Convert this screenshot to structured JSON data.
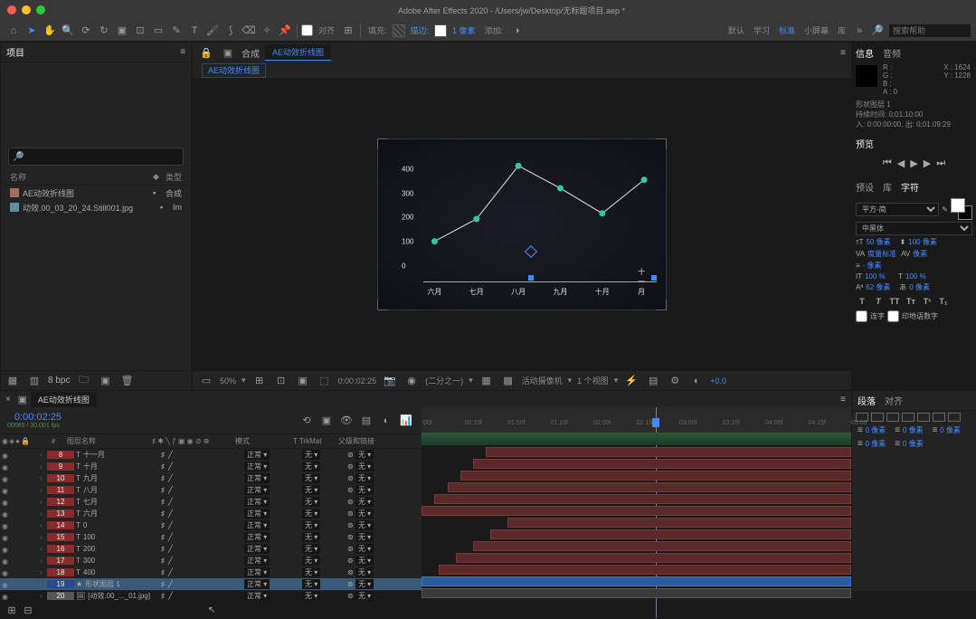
{
  "title": "Adobe After Effects 2020 - /Users/jw/Desktop/无标题项目.aep *",
  "toolbar": {
    "snap": "对齐",
    "fill": "填充:",
    "stroke": "描边:",
    "stroke_px": "1 像素",
    "add": "添加:",
    "workspace_default": "默认",
    "workspace_learn": "学习",
    "workspace_standard": "标准",
    "workspace_small": "小屏幕",
    "workspace_lib": "库",
    "search_placeholder": "搜索帮助"
  },
  "project": {
    "tab": "项目",
    "name_col": "名称",
    "type_col": "类型",
    "items": [
      {
        "name": "AE动效折线图",
        "type": "合成"
      },
      {
        "name": "动效.00_03_20_24.Still001.jpg",
        "type": "Im"
      }
    ],
    "bpc": "8 bpc"
  },
  "comp": {
    "prefix": "合成",
    "name": "AE动效折线图",
    "flow_tab": "AE动效折线图",
    "zoom": "50%",
    "time": "0:00:02:25",
    "res": "(二分之一)",
    "camera": "活动摄像机",
    "view": "1 个视图",
    "exposure": "+0.0"
  },
  "info": {
    "tab_info": "信息",
    "tab_audio": "音频",
    "r": "R :",
    "g": "G :",
    "b": "B :",
    "a": "A : 0",
    "x": "X : 1624",
    "y": "Y : 1228",
    "layer": "形状图层 1",
    "duration": "持续时间: 0;01:10:00",
    "in_out": "入: 0:00:00:00, 出: 0;01:09:29"
  },
  "preview": {
    "tab": "预览"
  },
  "char": {
    "tab_preset": "预设",
    "tab_lib": "库",
    "tab_char": "字符",
    "font": "平方-简",
    "weight": "中黑体",
    "size": "50 像素",
    "leading": "100 像素",
    "metrics": "度量标准",
    "kerning": "像素",
    "vscale": "100 %",
    "hscale": "100 %",
    "baseline": "0 像素",
    "stroke_w": "- 像素",
    "tracking": "62 像素",
    "ligature": "连字",
    "hindi": "印地语数字"
  },
  "chart_data": {
    "type": "line",
    "categories": [
      "六月",
      "七月",
      "八月",
      "九月",
      "十月",
      "十一月"
    ],
    "values": [
      150,
      230,
      420,
      340,
      250,
      370
    ],
    "ylabels": [
      "0",
      "100",
      "200",
      "300",
      "400"
    ],
    "ylim": [
      0,
      450
    ],
    "point_color": "#2ecc9a",
    "line_color": "#cccccc"
  },
  "timeline": {
    "tab": "AE动效折线图",
    "time": "0:00:02:25",
    "frame": "00085 / 30.001 fps",
    "col_source": "图层名称",
    "col_mode": "模式",
    "col_trkmat": "TrkMat",
    "col_parent": "父级和链接",
    "mode_normal": "正常",
    "trk_none": "无",
    "parent_none": "无",
    "layers": [
      {
        "idx": 8,
        "type": "T",
        "name": "十一月",
        "color": "red"
      },
      {
        "idx": 9,
        "type": "T",
        "name": "十月",
        "color": "red"
      },
      {
        "idx": 10,
        "type": "T",
        "name": "九月",
        "color": "red"
      },
      {
        "idx": 11,
        "type": "T",
        "name": "八月",
        "color": "red"
      },
      {
        "idx": 12,
        "type": "T",
        "name": "七月",
        "color": "red"
      },
      {
        "idx": 13,
        "type": "T",
        "name": "六月",
        "color": "red"
      },
      {
        "idx": 14,
        "type": "T",
        "name": "0",
        "color": "red"
      },
      {
        "idx": 15,
        "type": "T",
        "name": "100",
        "color": "red"
      },
      {
        "idx": 16,
        "type": "T",
        "name": "200",
        "color": "red"
      },
      {
        "idx": 17,
        "type": "T",
        "name": "300",
        "color": "red"
      },
      {
        "idx": 18,
        "type": "T",
        "name": "400",
        "color": "red"
      },
      {
        "idx": 19,
        "type": "★",
        "name": "形状图层 1",
        "color": "blue",
        "selected": true
      },
      {
        "idx": 20,
        "type": "img",
        "name": "[动效.00_..._01.jpg]",
        "color": "gray"
      }
    ],
    "ruler": [
      ":00f",
      "00:15f",
      "01:00f",
      "01:15f",
      "02:00f",
      "02:15f",
      "03:00f",
      "03:15f",
      "04:00f",
      "04:15f",
      "05:00"
    ]
  },
  "paragraph": {
    "tab_para": "段落",
    "tab_align": "对齐",
    "indent": "0 像素"
  }
}
